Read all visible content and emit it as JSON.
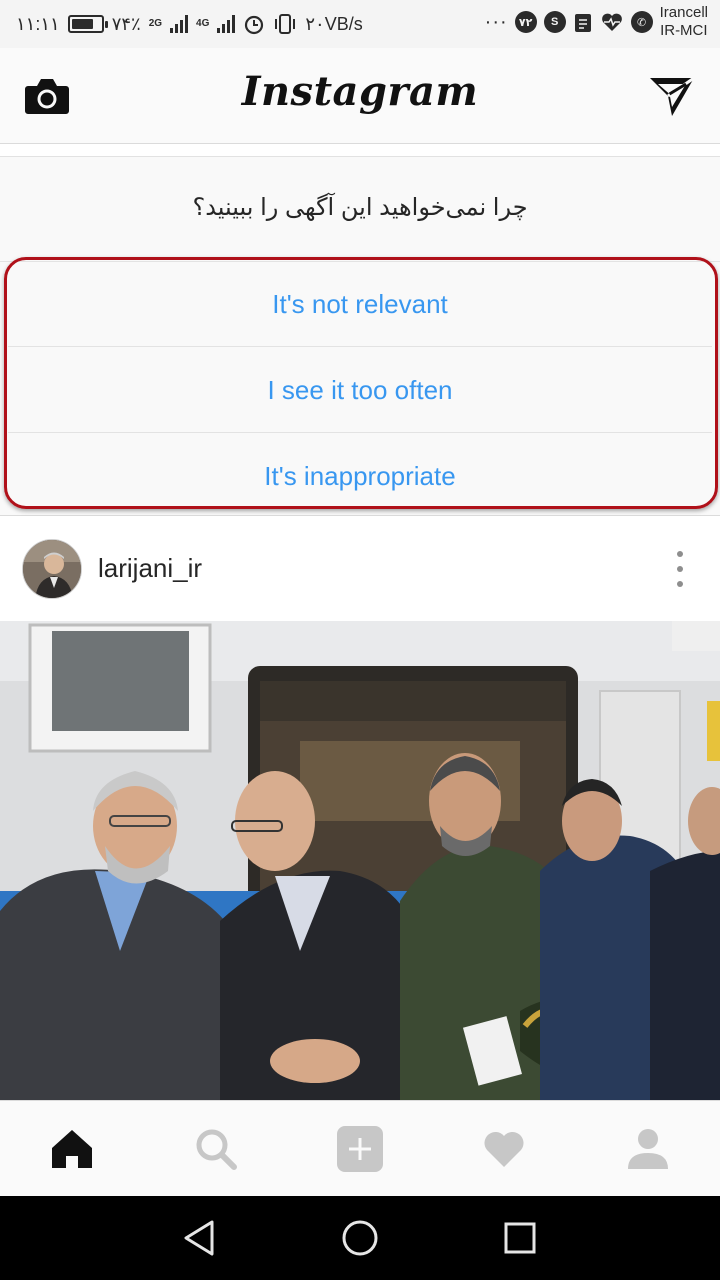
{
  "status_bar": {
    "time": "۱۱:۱۱",
    "battery_text": "۷۴٪",
    "battery_level": 0.74,
    "net_1": "2G",
    "net_2": "4G",
    "speed": "۲۰VB/s",
    "notif_count": "۷۲",
    "carrier_1": "Irancell",
    "carrier_2": "IR-MCI"
  },
  "header": {
    "logo": "Instagram"
  },
  "ad_feedback": {
    "question": "چرا نمی‌خواهید این آگهی را ببینید؟",
    "options": [
      "It's not relevant",
      "I see it too often",
      "It's inappropriate"
    ]
  },
  "post": {
    "username": "larijani_ir"
  },
  "colors": {
    "link_blue": "#3897f0",
    "highlight_red": "#b0111a",
    "text_dark": "#262626",
    "icon_gray": "#c7c7c7"
  },
  "icons": {
    "header_left": "camera-icon",
    "header_right": "direct-message-icon",
    "nav": [
      "home-icon",
      "search-icon",
      "add-post-icon",
      "heart-icon",
      "profile-icon"
    ],
    "system": [
      "back-icon",
      "home-circle-icon",
      "recents-icon"
    ]
  }
}
